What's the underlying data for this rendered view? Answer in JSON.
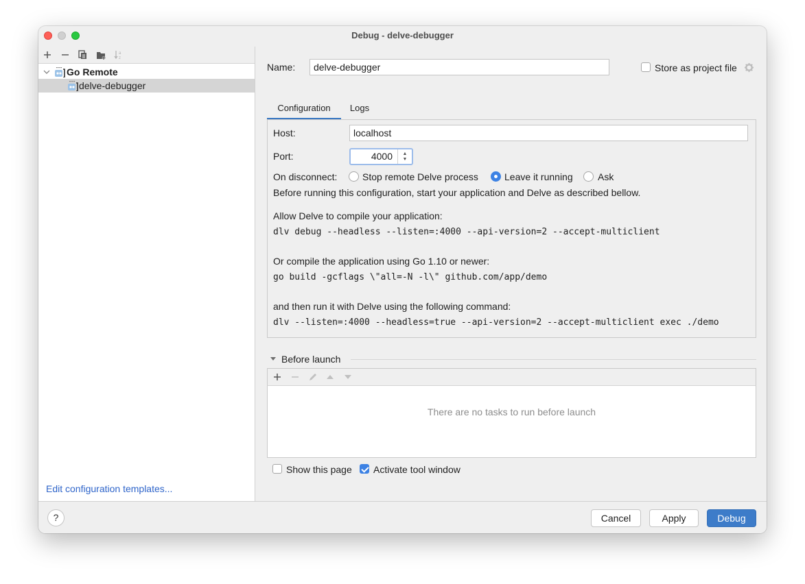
{
  "window": {
    "title": "Debug - delve-debugger"
  },
  "left": {
    "toolbar": [
      {
        "name": "add-icon",
        "glyph": "+"
      },
      {
        "name": "remove-icon",
        "glyph": "−"
      },
      {
        "name": "copy-icon",
        "glyph": "⧉"
      },
      {
        "name": "new-folder-icon",
        "glyph": "▰"
      },
      {
        "name": "sort-icon",
        "glyph": "↓ᵃᶻ"
      }
    ],
    "tree": [
      {
        "label": "Go Remote",
        "type": "group",
        "expanded": true
      },
      {
        "label": "delve-debugger",
        "type": "item",
        "selected": true
      }
    ],
    "edit_templates": "Edit configuration templates..."
  },
  "form": {
    "name_label": "Name:",
    "name_value": "delve-debugger",
    "store_label": "Store as project file",
    "store_checked": false,
    "tabs": [
      {
        "label": "Configuration",
        "active": true
      },
      {
        "label": "Logs",
        "active": false
      }
    ],
    "host_label": "Host:",
    "host_value": "localhost",
    "port_label": "Port:",
    "port_value": "4000",
    "disconnect_label": "On disconnect:",
    "disconnect_options": [
      {
        "label": "Stop remote Delve process",
        "selected": false
      },
      {
        "label": "Leave it running",
        "selected": true
      },
      {
        "label": "Ask",
        "selected": false
      }
    ],
    "intro": "Before running this configuration, start your application and Delve as described bellow.",
    "step1_label": "Allow Delve to compile your application:",
    "step1_cmd": "dlv debug --headless --listen=:4000 --api-version=2 --accept-multiclient",
    "step2_label": "Or compile the application using Go 1.10 or newer:",
    "step2_cmd": "go build -gcflags \\\"all=-N -l\\\" github.com/app/demo",
    "step3_label": "and then run it with Delve using the following command:",
    "step3_cmd": "dlv --listen=:4000 --headless=true --api-version=2 --accept-multiclient exec ./demo"
  },
  "before_launch": {
    "title": "Before launch",
    "empty_text": "There are no tasks to run before launch",
    "show_page_label": "Show this page",
    "show_page_checked": false,
    "activate_label": "Activate tool window",
    "activate_checked": true
  },
  "footer": {
    "help": "?",
    "cancel": "Cancel",
    "apply": "Apply",
    "debug": "Debug"
  }
}
